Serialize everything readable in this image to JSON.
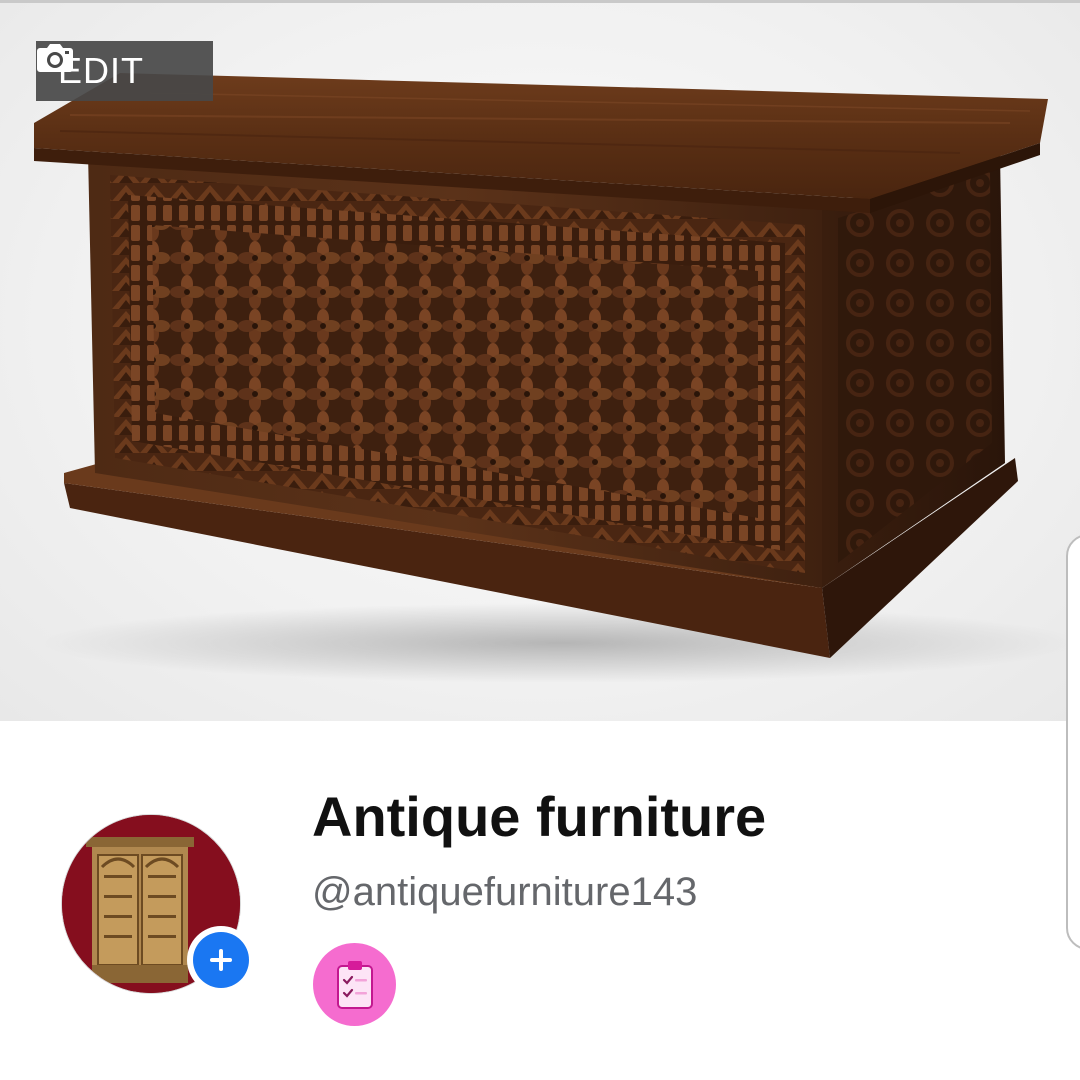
{
  "cover": {
    "edit_label": "EDIT",
    "edit_icon": "camera-icon",
    "image_subject": "carved-wooden-chest"
  },
  "profile": {
    "name": "Antique furniture",
    "handle": "@antiquefurniture143",
    "avatar_subject": "carved-wooden-cabinet",
    "add_icon": "plus-icon",
    "badge_icon": "clipboard-checklist-icon"
  },
  "colors": {
    "accent_blue": "#1a77f2",
    "badge_pink": "#f56ccf",
    "name_text": "#111111",
    "handle_text": "#65676b",
    "edit_bg": "#484848"
  }
}
